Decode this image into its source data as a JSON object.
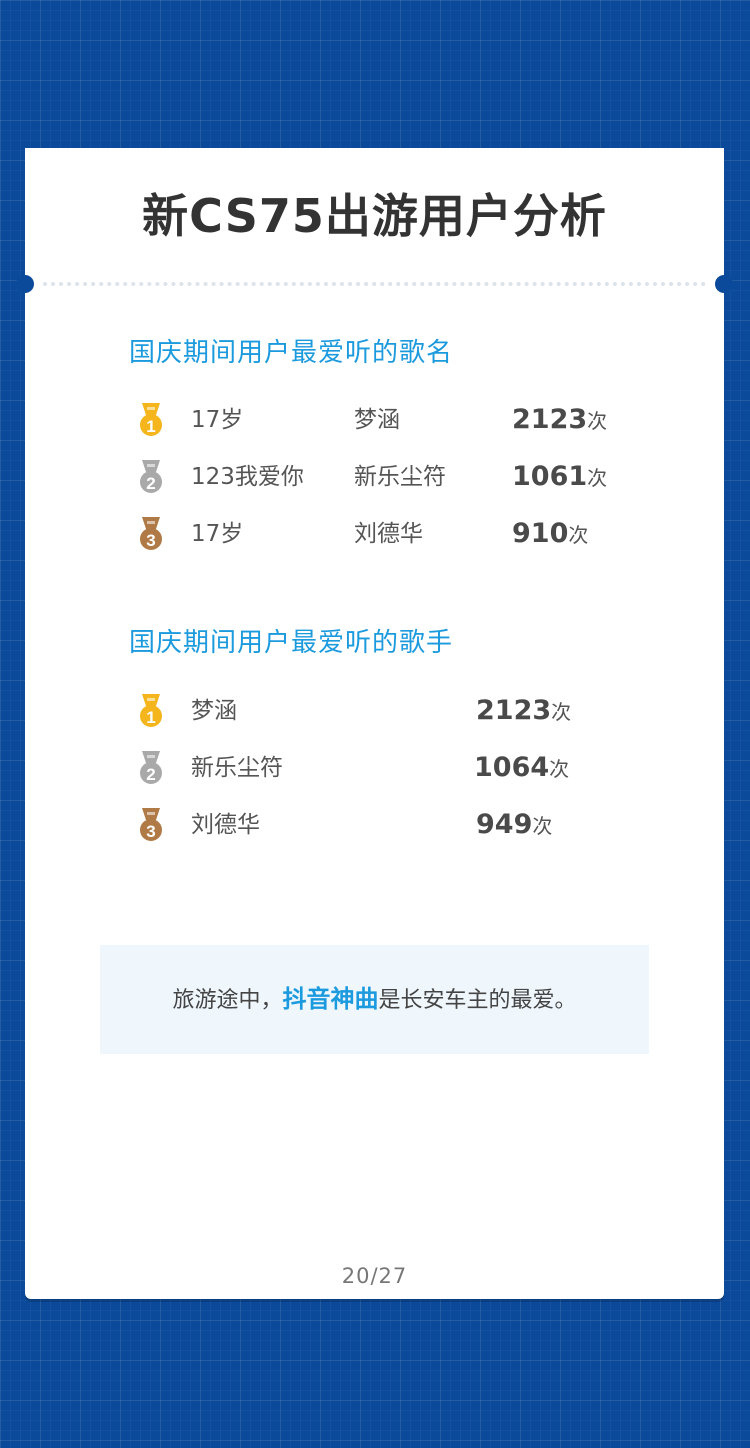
{
  "title": "新CS75出游用户分析",
  "songs": {
    "heading": "国庆期间用户最爱听的歌名",
    "rows": [
      {
        "rank": "1",
        "song": "17岁",
        "artist": "梦涵",
        "count": "2123",
        "unit": "次",
        "medal_color": "#f5b51c"
      },
      {
        "rank": "2",
        "song": "123我爱你",
        "artist": "新乐尘符",
        "count": "1061",
        "unit": "次",
        "medal_color": "#a9a9a9"
      },
      {
        "rank": "3",
        "song": "17岁",
        "artist": "刘德华",
        "count": "910",
        "unit": "次",
        "medal_color": "#b07a46"
      }
    ]
  },
  "singers": {
    "heading": "国庆期间用户最爱听的歌手",
    "rows": [
      {
        "rank": "1",
        "singer": "梦涵",
        "count": "2123",
        "unit": "次",
        "medal_color": "#f5b51c"
      },
      {
        "rank": "2",
        "singer": "新乐尘符",
        "count": "1064",
        "unit": "次",
        "medal_color": "#a9a9a9"
      },
      {
        "rank": "3",
        "singer": "刘德华",
        "count": "949",
        "unit": "次",
        "medal_color": "#b07a46"
      }
    ]
  },
  "note": {
    "prefix": "旅游途中，",
    "highlight": "抖音神曲",
    "suffix": "是长安车主的最爱。"
  },
  "page": "20/27",
  "colors": {
    "background": "#0b4a9a",
    "accent": "#1c9ade",
    "gold": "#f5b51c",
    "silver": "#a9a9a9",
    "bronze": "#b07a46"
  }
}
